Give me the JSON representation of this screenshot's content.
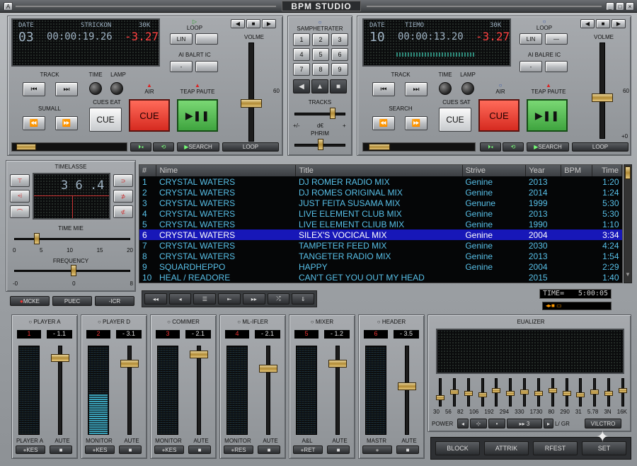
{
  "app": {
    "title": "BPM STUDIO",
    "menu_icon": "A"
  },
  "deckA": {
    "display": {
      "date_label": "DATE",
      "info_label": "STRICKON",
      "khz": "30K",
      "track_num": "03",
      "time": "00:00:19.26",
      "pitch": "-3.27"
    },
    "loop_label": "LOOP",
    "loop_btn1": "LIN",
    "loop_btn2": "",
    "autobreak_label": "AI BALRT IC",
    "autobreak_btn1": "-",
    "autobreak_btn2": "",
    "volume_label": "VOLME",
    "volume_scale": "60",
    "track_label": "TRACK",
    "time_label": "TIME",
    "lamp_label": "LAMP",
    "air_label": "AIR",
    "pause_label": "TEAP PAUTE",
    "search_label": "SUMALL",
    "cue_set_label": "CUES EAT",
    "cue_button": "CUE",
    "cue_big": "CUE",
    "bottom": {
      "search": "SEARCH",
      "loop": "LOOP"
    }
  },
  "deckB": {
    "display": {
      "date_label": "DATE",
      "info_label": "TIEMO",
      "khz": "30K",
      "track_num": "10",
      "time": "00:00:13.20",
      "pitch": "-3.27"
    },
    "loop_label": "LOOP",
    "loop_btn1": "LIN",
    "loop_btn2": "—",
    "autobreak_label": "AI BALRE IC",
    "autobreak_btn1": "-",
    "autobreak_btn2": "",
    "volume_label": "VOLME",
    "volume_scale": "60",
    "volume_scale_bottom": "+0",
    "track_label": "TRACK",
    "time_label": "TIME",
    "lamp_label": "LAMP",
    "air_label": "AIR",
    "pause_label": "TEAP PAUTE",
    "search_label": "SEARCH",
    "cue_set_label": "CUES SAT",
    "cue_button": "CUE",
    "cue_big": "CUE",
    "bottom": {
      "search": "SEARCH",
      "loop": "LOOP"
    }
  },
  "center": {
    "sampler_label": "SAMPHETRATER",
    "keys": [
      "1",
      "2",
      "3",
      "4",
      "5",
      "6",
      "7",
      "8",
      "9"
    ],
    "tracks_label": "TRACKS",
    "pitch_scale": [
      "+/-",
      "d€",
      "+"
    ],
    "pitch2_label": "PHRIM"
  },
  "timelasse": {
    "title": "TIMELASSE",
    "display": "3 6 .4",
    "time_mie_label": "TIME MIE",
    "time_scale": [
      "0",
      "5",
      "10",
      "15",
      "20"
    ],
    "frequency_label": "FREQUENCY",
    "freq_scale": [
      "-0",
      "0",
      "8"
    ],
    "buttons": [
      "MCKE",
      "PUEC",
      "-ICR"
    ]
  },
  "playlist": {
    "columns": [
      "#",
      "Nime",
      "Title",
      "Strive",
      "Year",
      "BPM",
      "Time"
    ],
    "rows": [
      {
        "n": "1",
        "name": "CRYSTAL WATERS",
        "title": "DJ ROMER RADIO MIX",
        "genre": "Genine",
        "year": "2013",
        "bpm": "",
        "time": "1:20",
        "style": ""
      },
      {
        "n": "2",
        "name": "CRYSTAL WATERS",
        "title": "DJ ROMES ORIGINAL MIX",
        "genre": "Genine",
        "year": "2014",
        "bpm": "",
        "time": "1:24",
        "style": ""
      },
      {
        "n": "3",
        "name": "CRYSTAL WATERS",
        "title": "JUST FEITA SUSAMA MIX",
        "genre": "Genune",
        "year": "1999",
        "bpm": "",
        "time": "5:30",
        "style": "gold"
      },
      {
        "n": "4",
        "name": "CRYSTAL WATERS",
        "title": "LIVE ELEMENT CLUB MIX",
        "genre": "Genine",
        "year": "2013",
        "bpm": "",
        "time": "5:30",
        "style": ""
      },
      {
        "n": "5",
        "name": "CRYSTAL WATERS",
        "title": "LIVE ELEMENT CLIUB MIX",
        "genre": "Genine",
        "year": "1990",
        "bpm": "",
        "time": "1:10",
        "style": ""
      },
      {
        "n": "6",
        "name": "CRYSTAL WATERS",
        "title": "SILEX'S VOCICAL MIX",
        "genre": "Genine",
        "year": "2004",
        "bpm": "",
        "time": "3:34",
        "style": "sel"
      },
      {
        "n": "7",
        "name": "CRYSTAL WATERS",
        "title": "TAMPETER FEED MIX",
        "genre": "Genine",
        "year": "2030",
        "bpm": "",
        "time": "4:24",
        "style": ""
      },
      {
        "n": "8",
        "name": "CRYSTAL WATERS",
        "title": "TANGETER RADIO MIX",
        "genre": "Genine",
        "year": "2013",
        "bpm": "",
        "time": "1:54",
        "style": ""
      },
      {
        "n": "9",
        "name": "SQUARDHEPPO",
        "title": "HAPPY",
        "genre": "Genine",
        "year": "2004",
        "bpm": "",
        "time": "2:29",
        "style": ""
      },
      {
        "n": "10",
        "name": "HEAL / READORE",
        "title": "CAN'T GET YOU OUT MY HEAD",
        "genre": "",
        "year": "2015",
        "bpm": "",
        "time": "1:40",
        "style": "red"
      }
    ],
    "time_display": {
      "label": "TIME=",
      "value": "5:00:05"
    }
  },
  "mixer": {
    "channels": [
      {
        "title": "PLAYER A",
        "num": "1",
        "val": "- 1.1",
        "foot_label": "PLAYER A",
        "auto": "AUTE",
        "btn": "KES",
        "level": 0.0
      },
      {
        "title": "PLAYER D",
        "num": "2",
        "val": "- 3.1",
        "foot_label": "MONITOR",
        "auto": "AUTE",
        "btn": "KES",
        "level": 0.45
      },
      {
        "title": "COMIMER",
        "num": "3",
        "val": "- 2.1",
        "foot_label": "MONITOR",
        "auto": "AUTE",
        "btn": "KES",
        "level": 0.0
      },
      {
        "title": "ML-IFLER",
        "num": "4",
        "val": "- 2.1",
        "foot_label": "MONITOR",
        "auto": "AUTE",
        "btn": "RES",
        "level": 0.0
      },
      {
        "title": "MIXER",
        "num": "5",
        "val": "- 1.2",
        "foot_label": "A&L",
        "auto": "AUTE",
        "btn": "RET",
        "level": 0.0
      },
      {
        "title": "HEADER",
        "num": "6",
        "val": "- 3.5",
        "foot_label": "MASTR",
        "auto": "AUTE",
        "btn": "",
        "level": 0.0
      }
    ]
  },
  "equalizer": {
    "title": "EUALIZER",
    "bands": [
      "30",
      "56",
      "82",
      "106",
      "192",
      "294",
      "330",
      "1730",
      "80",
      "290",
      "31",
      "5.78",
      "3N",
      "16K"
    ],
    "power_label": "POWER",
    "lr_label": "L/ GR",
    "preset_btn": "VILCTRO",
    "footer": [
      "BLOCK",
      "ATTRIK",
      "RFEST",
      "SET"
    ]
  },
  "colors": {
    "lcd_text": "#9fb3c4",
    "playlist_text": "#58c0e8",
    "selected_row": "#1717b8",
    "cue_red": "#e2362c",
    "play_green": "#47b649"
  }
}
